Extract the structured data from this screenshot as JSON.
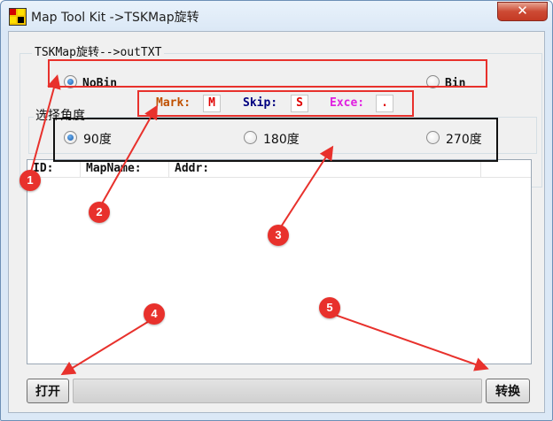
{
  "window": {
    "title": "Map Tool Kit ->TSKMap旋转",
    "close_glyph": "✕"
  },
  "group": {
    "legend": "TSKMap旋转-->outTXT"
  },
  "mode": {
    "options": [
      {
        "label": "NoBin",
        "selected": true
      },
      {
        "label": "Bin",
        "selected": false
      }
    ]
  },
  "codes": {
    "mark_label": "Mark:",
    "mark_value": "M",
    "skip_label": "Skip:",
    "skip_value": "S",
    "exce_label": "Exce:",
    "exce_value": ".",
    "mark_color": "#c05000",
    "skip_color": "#000080",
    "exce_color": "#e020e0"
  },
  "angle": {
    "label": "选择角度",
    "options": [
      {
        "label": "90度",
        "selected": true
      },
      {
        "label": "180度",
        "selected": false
      },
      {
        "label": "270度",
        "selected": false
      }
    ]
  },
  "list": {
    "columns": [
      "ID:",
      "MapName:",
      "Addr:"
    ]
  },
  "buttons": {
    "open": "打开",
    "convert": "转换"
  },
  "annotations": {
    "badges": [
      "1",
      "2",
      "3",
      "4",
      "5"
    ],
    "color": "#e8312c"
  }
}
